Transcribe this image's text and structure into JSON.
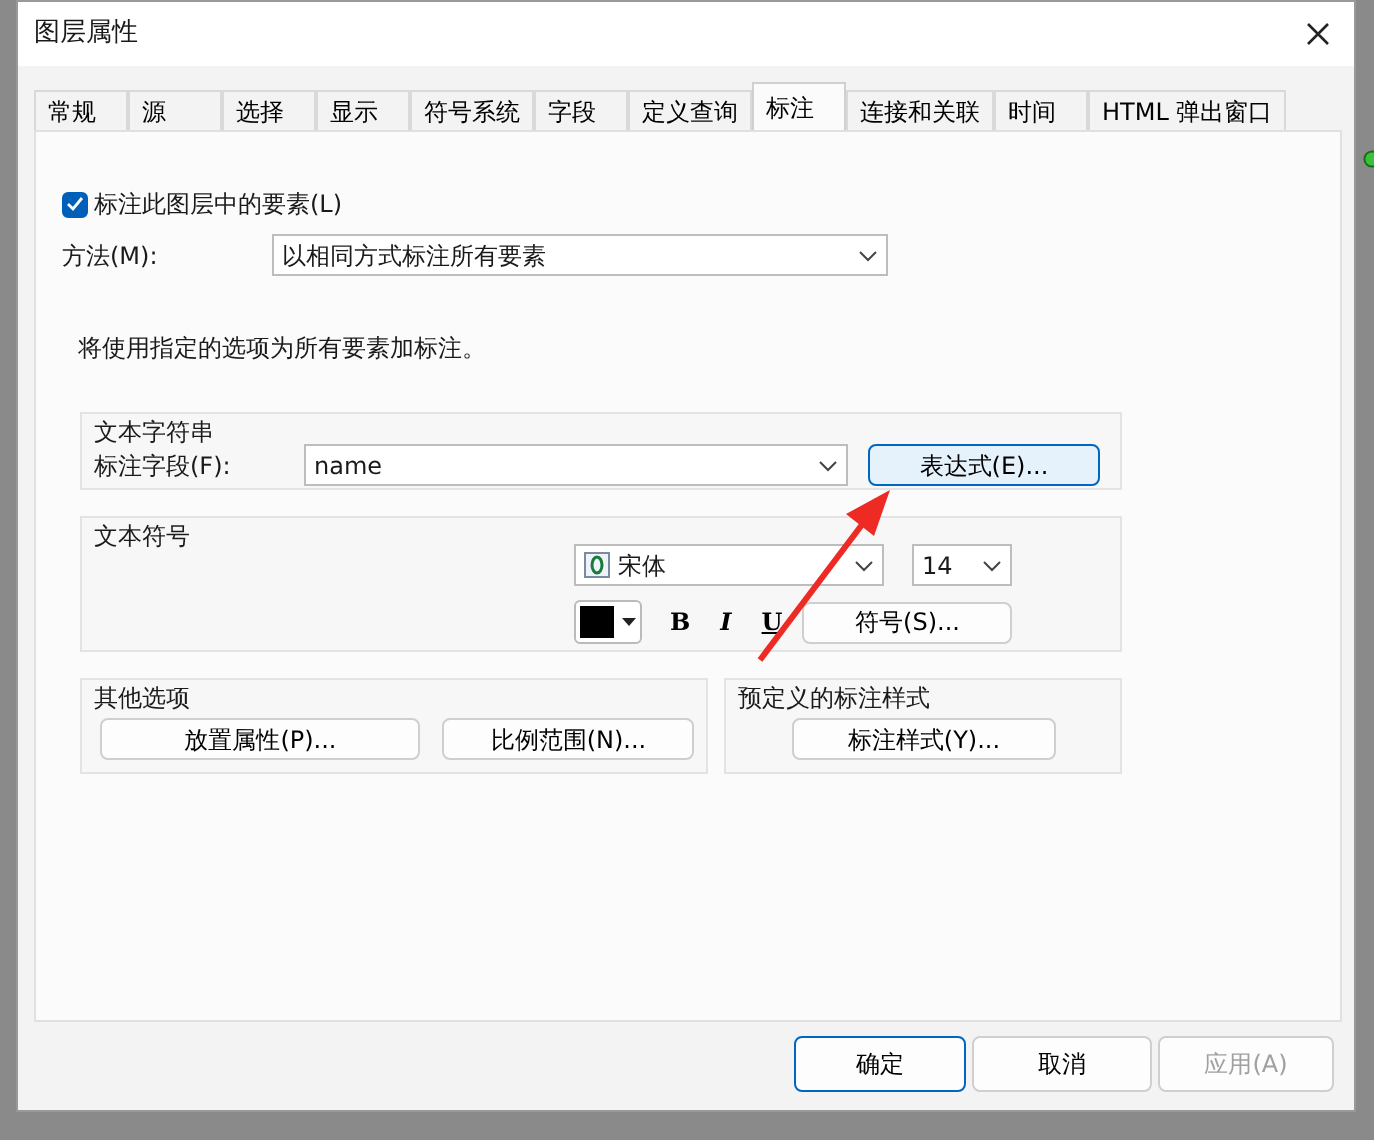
{
  "window": {
    "title": "图层属性"
  },
  "tabs": [
    {
      "label": "常规",
      "selected": false
    },
    {
      "label": "源",
      "selected": false
    },
    {
      "label": "选择",
      "selected": false
    },
    {
      "label": "显示",
      "selected": false
    },
    {
      "label": "符号系统",
      "selected": false
    },
    {
      "label": "字段",
      "selected": false
    },
    {
      "label": "定义查询",
      "selected": false
    },
    {
      "label": "标注",
      "selected": true
    },
    {
      "label": "连接和关联",
      "selected": false
    },
    {
      "label": "时间",
      "selected": false
    },
    {
      "label": "HTML 弹出窗口",
      "selected": false
    }
  ],
  "label_features": {
    "label": "标注此图层中的要素(L)",
    "checked": true
  },
  "method": {
    "label": "方法(M):",
    "value": "以相同方式标注所有要素"
  },
  "description": "将使用指定的选项为所有要素加标注。",
  "text_string": {
    "title": "文本字符串",
    "field_label": "标注字段(F):",
    "field_value": "name",
    "button": "表达式(E)..."
  },
  "text_symbol": {
    "title": "文本符号",
    "font": "宋体",
    "size": "14",
    "color": "#000000",
    "bold": "B",
    "italic": "I",
    "underline": "U",
    "button": "符号(S)..."
  },
  "other_options": {
    "title": "其他选项",
    "buttons": [
      "放置属性(P)...",
      "比例范围(N)..."
    ]
  },
  "predefined": {
    "title": "预定义的标注样式",
    "button": "标注样式(Y)..."
  },
  "footer_buttons": [
    {
      "label": "确定",
      "focused": true,
      "disabled": false
    },
    {
      "label": "取消",
      "focused": false,
      "disabled": false
    },
    {
      "label": "应用(A)",
      "focused": false,
      "disabled": true
    }
  ]
}
